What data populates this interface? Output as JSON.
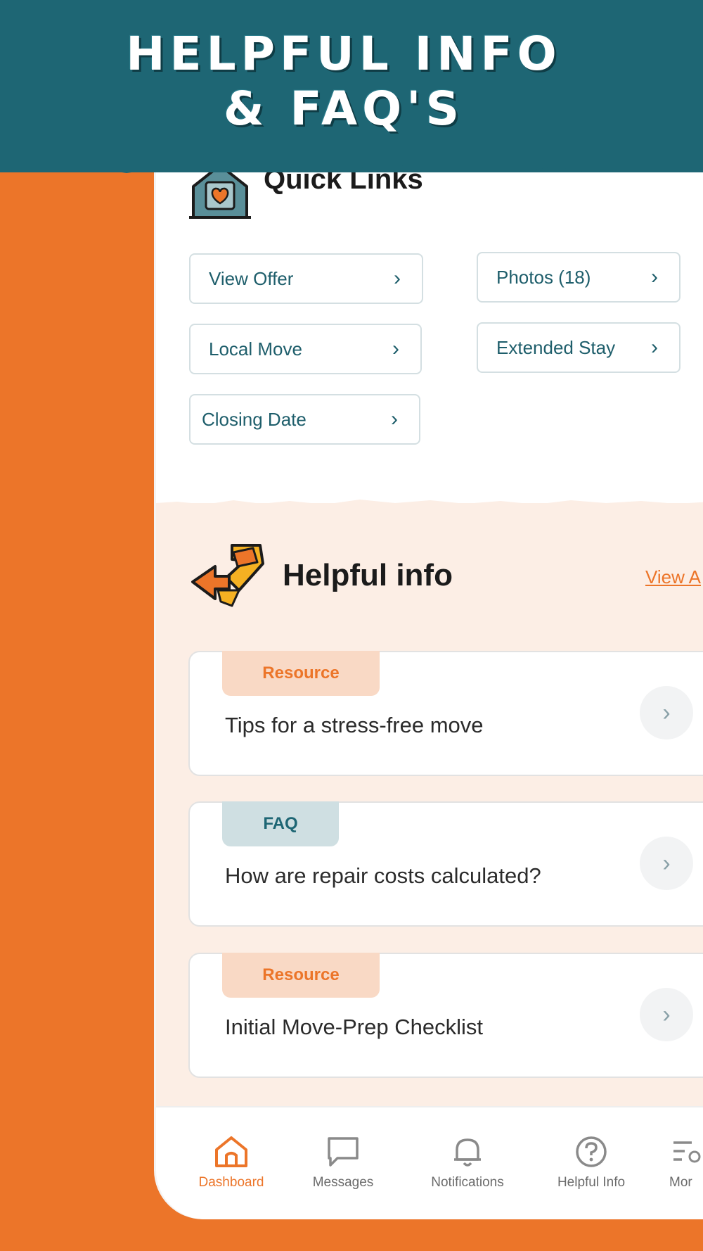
{
  "banner": {
    "line1": "HELPFUL INFO",
    "line2": "& FAQ'S"
  },
  "quick_links": {
    "title": "Quick Links",
    "buttons": [
      {
        "label": "View Offer"
      },
      {
        "label": "Photos (18)"
      },
      {
        "label": "Local Move"
      },
      {
        "label": "Extended Stay"
      },
      {
        "label": "Closing Date"
      }
    ],
    "chevron": "›"
  },
  "helpful_info": {
    "title": "Helpful info",
    "view_all": "View A",
    "items": [
      {
        "tag": "Resource",
        "title": "Tips for a stress-free move"
      },
      {
        "tag": "FAQ",
        "title": "How are repair costs calculated?"
      },
      {
        "tag": "Resource",
        "title": "Initial Move-Prep Checklist"
      }
    ],
    "arrow": "›"
  },
  "bottom_nav": {
    "items": [
      {
        "label": "Dashboard",
        "icon": "home-icon",
        "active": true
      },
      {
        "label": "Messages",
        "icon": "chat-icon"
      },
      {
        "label": "Notifications",
        "icon": "bell-icon"
      },
      {
        "label": "Helpful Info",
        "icon": "question-icon"
      },
      {
        "label": "Mor",
        "icon": "more-icon"
      }
    ]
  },
  "colors": {
    "orange": "#EC7529",
    "teal": "#1E6674",
    "peach": "#FCEEE5",
    "resource_tag_bg": "#F9D9C5",
    "faq_tag_bg": "#CFDFE2"
  }
}
